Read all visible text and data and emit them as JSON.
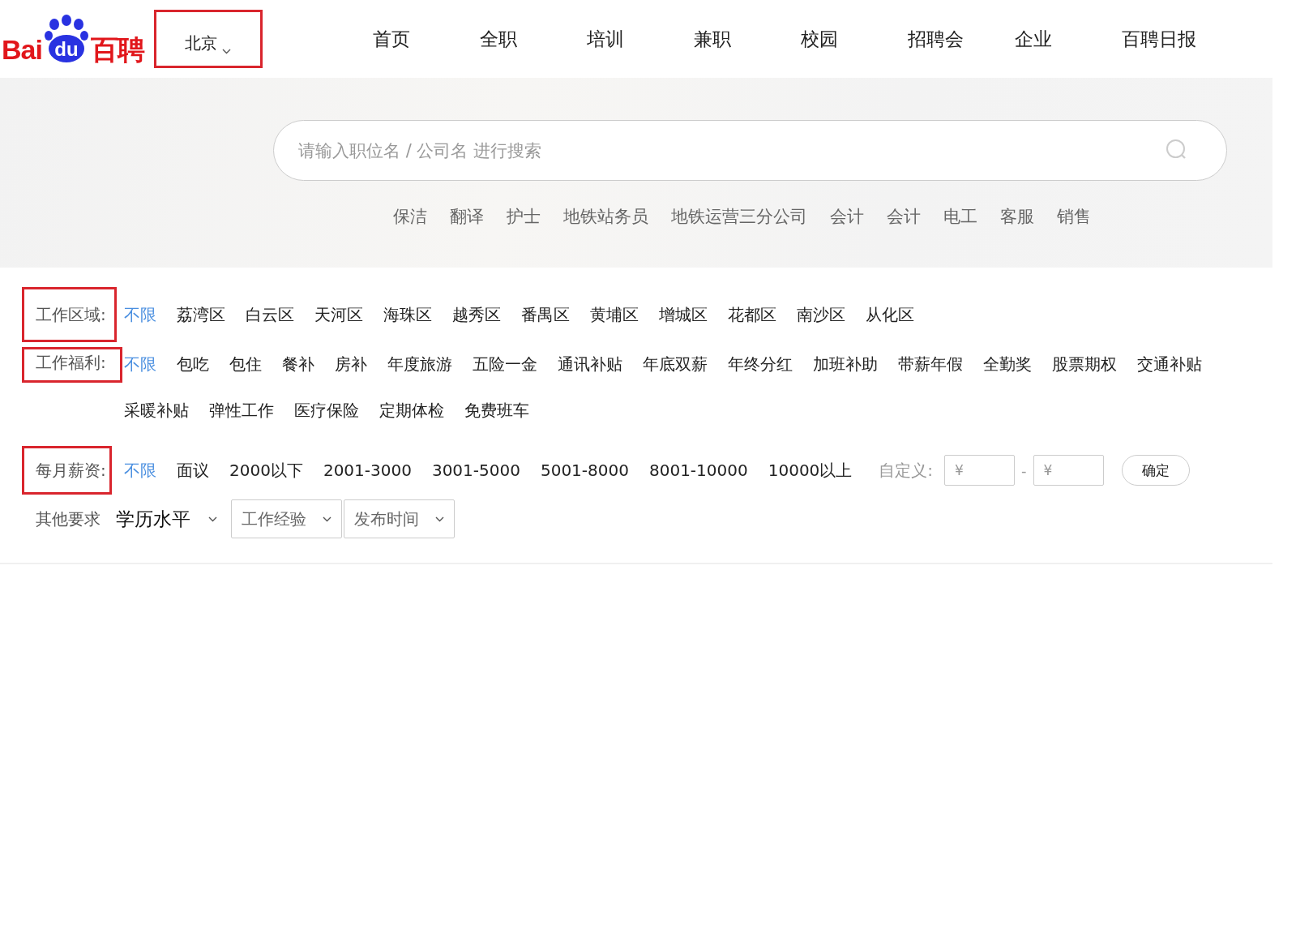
{
  "logo": {
    "latin": "Bai",
    "paw_text": "du",
    "chinese": "百聘"
  },
  "city_selector": {
    "label": "北京",
    "highlighted": true
  },
  "nav": [
    {
      "label": "首页"
    },
    {
      "label": "全职"
    },
    {
      "label": "培训"
    },
    {
      "label": "兼职"
    },
    {
      "label": "校园"
    },
    {
      "label": "招聘会"
    },
    {
      "label": "企业"
    },
    {
      "label": "百聘日报"
    }
  ],
  "search": {
    "placeholder": "请输入职位名 / 公司名 进行搜索"
  },
  "hot_tags": [
    "保洁",
    "翻译",
    "护士",
    "地铁站务员",
    "地铁运营三分公司",
    "会计",
    "会计",
    "电工",
    "客服",
    "销售"
  ],
  "filters": [
    {
      "label": "工作区域:",
      "highlighted": true,
      "options": [
        {
          "label": "不限",
          "selected": true
        },
        {
          "label": "荔湾区",
          "selected": false
        },
        {
          "label": "白云区",
          "selected": false
        },
        {
          "label": "天河区",
          "selected": false
        },
        {
          "label": "海珠区",
          "selected": false
        },
        {
          "label": "越秀区",
          "selected": false
        },
        {
          "label": "番禺区",
          "selected": false
        },
        {
          "label": "黄埔区",
          "selected": false
        },
        {
          "label": "增城区",
          "selected": false
        },
        {
          "label": "花都区",
          "selected": false
        },
        {
          "label": "南沙区",
          "selected": false
        },
        {
          "label": "从化区",
          "selected": false
        }
      ]
    },
    {
      "label": "工作福利:",
      "highlighted": true,
      "options": [
        {
          "label": "不限",
          "selected": true
        },
        {
          "label": "包吃",
          "selected": false
        },
        {
          "label": "包住",
          "selected": false
        },
        {
          "label": "餐补",
          "selected": false
        },
        {
          "label": "房补",
          "selected": false
        },
        {
          "label": "年度旅游",
          "selected": false
        },
        {
          "label": "五险一金",
          "selected": false
        },
        {
          "label": "通讯补贴",
          "selected": false
        },
        {
          "label": "年底双薪",
          "selected": false
        },
        {
          "label": "年终分红",
          "selected": false
        },
        {
          "label": "加班补助",
          "selected": false
        },
        {
          "label": "带薪年假",
          "selected": false
        },
        {
          "label": "全勤奖",
          "selected": false
        },
        {
          "label": "股票期权",
          "selected": false
        },
        {
          "label": "交通补贴",
          "selected": false
        },
        {
          "label": "采暖补贴",
          "selected": false
        },
        {
          "label": "弹性工作",
          "selected": false
        },
        {
          "label": "医疗保险",
          "selected": false
        },
        {
          "label": "定期体检",
          "selected": false
        },
        {
          "label": "免费班车",
          "selected": false
        }
      ]
    },
    {
      "label": "每月薪资:",
      "highlighted": true,
      "options": [
        {
          "label": "不限",
          "selected": true
        },
        {
          "label": "面议",
          "selected": false
        },
        {
          "label": "2000以下",
          "selected": false
        },
        {
          "label": "2001-3000",
          "selected": false
        },
        {
          "label": "3001-5000",
          "selected": false
        },
        {
          "label": "5001-8000",
          "selected": false
        },
        {
          "label": "8001-10000",
          "selected": false
        },
        {
          "label": "10000以上",
          "selected": false
        }
      ],
      "custom": {
        "label": "自定义:",
        "min_placeholder": "¥",
        "separator": "-",
        "max_placeholder": "¥",
        "button": "确定"
      }
    }
  ],
  "other": {
    "label": "其他要求",
    "dropdowns": [
      {
        "label": "学历水平",
        "kind": "plain"
      },
      {
        "label": "工作经验",
        "kind": "boxed"
      },
      {
        "label": "发布时间",
        "kind": "boxed"
      }
    ]
  }
}
